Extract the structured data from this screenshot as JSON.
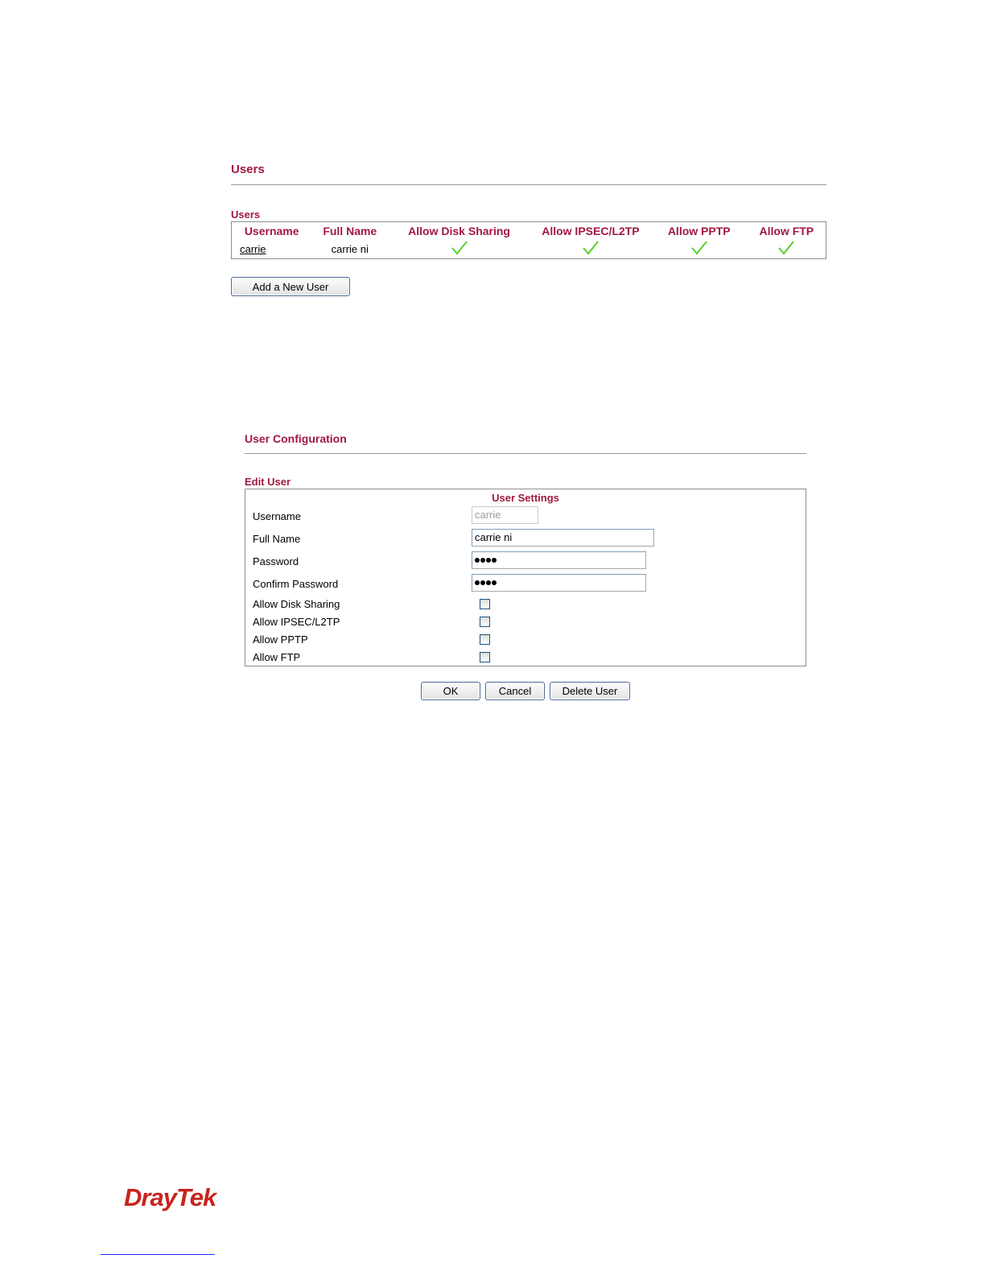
{
  "users_section": {
    "title": "Users",
    "subtitle": "Users",
    "columns": [
      "Username",
      "Full Name",
      "Allow Disk Sharing",
      "Allow IPSEC/L2TP",
      "Allow PPTP",
      "Allow FTP"
    ],
    "rows": [
      {
        "username": "carrie",
        "full_name": "carrie ni",
        "allow_disk_sharing": true,
        "allow_ipsec_l2tp": true,
        "allow_pptp": true,
        "allow_ftp": true
      }
    ],
    "add_button": "Add a New User"
  },
  "config_section": {
    "title": "User Configuration",
    "subtitle": "Edit User",
    "settings_header": "User Settings",
    "fields": {
      "username_label": "Username",
      "username_value": "carrie",
      "fullname_label": "Full Name",
      "fullname_value": "carrie ni",
      "password_label": "Password",
      "password_mask_length": 4,
      "confirm_label": "Confirm Password",
      "confirm_mask_length": 4
    },
    "checkboxes": [
      {
        "label": "Allow Disk Sharing",
        "checked": false
      },
      {
        "label": "Allow IPSEC/L2TP",
        "checked": false
      },
      {
        "label": "Allow PPTP",
        "checked": false
      },
      {
        "label": "Allow FTP",
        "checked": false
      }
    ],
    "buttons": {
      "ok": "OK",
      "cancel": "Cancel",
      "delete": "Delete User"
    }
  },
  "footer": {
    "logo_text": "DrayTek"
  },
  "colors": {
    "heading": "#a0193f",
    "check": "#56d12a",
    "logo": "#c8231d"
  }
}
